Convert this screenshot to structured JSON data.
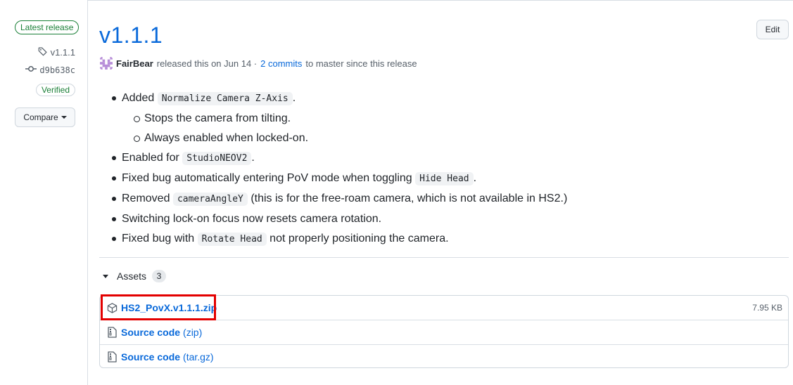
{
  "sidebar": {
    "latest_label": "Latest release",
    "tag": "v1.1.1",
    "commit": "d9b638c",
    "verified_label": "Verified",
    "compare_label": "Compare"
  },
  "release": {
    "title": "v1.1.1",
    "edit_label": "Edit",
    "author": "FairBear",
    "released_text": "released this on Jun 14 ·",
    "commits_link": "2 commits",
    "commits_suffix": "to master since this release"
  },
  "notes": {
    "item1_prefix": "Added",
    "item1_code": "Normalize Camera Z-Axis",
    "item1_suffix": ".",
    "sub1": "Stops the camera from tilting.",
    "sub2": "Always enabled when locked-on.",
    "item2_prefix": "Enabled for",
    "item2_code": "StudioNEOV2",
    "item2_suffix": ".",
    "item3_prefix": "Fixed bug automatically entering PoV mode when toggling",
    "item3_code": "Hide Head",
    "item3_suffix": ".",
    "item4_prefix": "Removed",
    "item4_code": "cameraAngleY",
    "item4_suffix": "(this is for the free-roam camera, which is not available in HS2.)",
    "item5": "Switching lock-on focus now resets camera rotation.",
    "item6_prefix": "Fixed bug with",
    "item6_code": "Rotate Head",
    "item6_suffix": "not properly positioning the camera."
  },
  "assets": {
    "label": "Assets",
    "count": "3",
    "items": [
      {
        "name": "HS2_PovX.v1.1.1.zip",
        "size": "7.95 KB",
        "icon": "package-icon"
      },
      {
        "name": "Source code",
        "paren": "(zip)",
        "icon": "file-zip-icon"
      },
      {
        "name": "Source code",
        "paren": "(tar.gz)",
        "icon": "file-zip-icon"
      }
    ]
  },
  "colors": {
    "link": "#0969da",
    "success": "#1a7f37",
    "highlight": "#e30000"
  }
}
